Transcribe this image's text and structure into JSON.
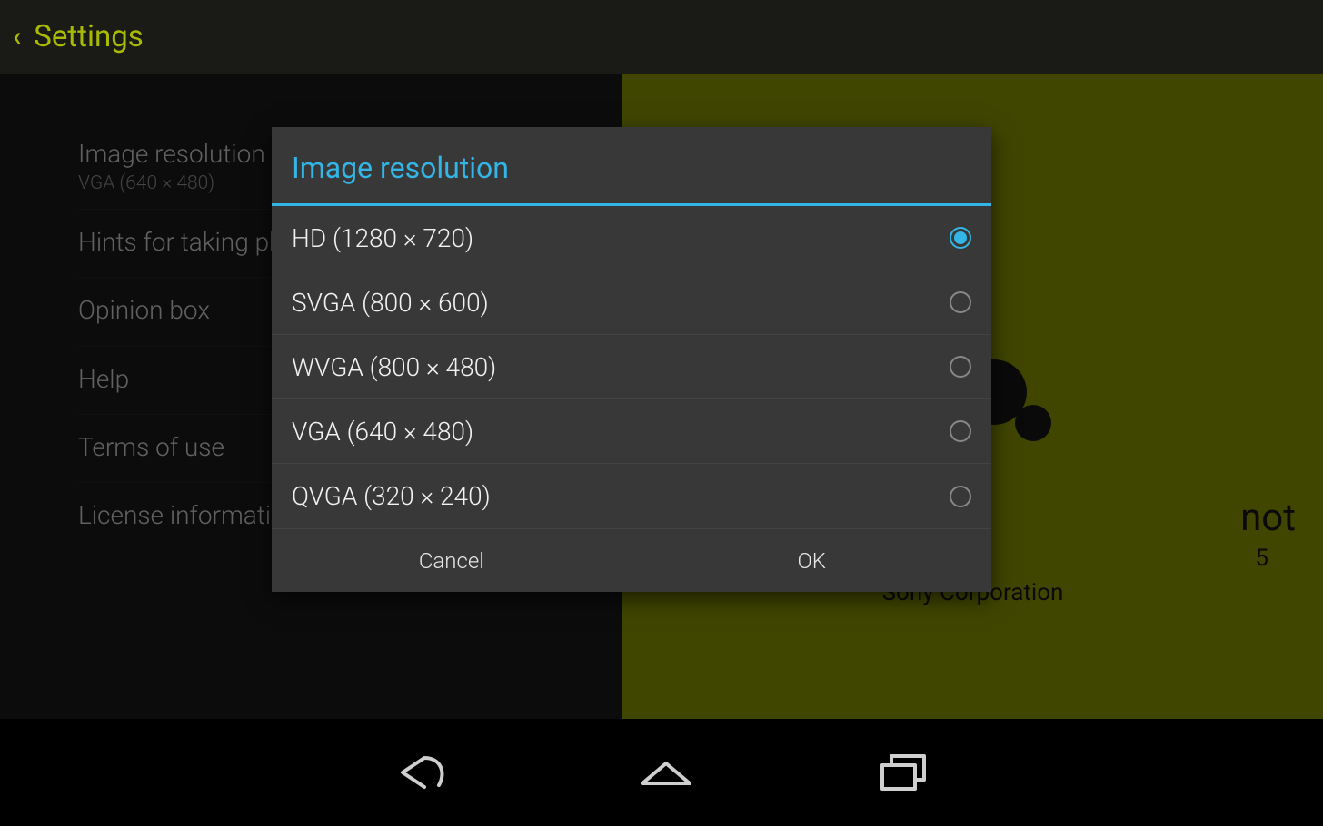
{
  "header": {
    "title": "Settings"
  },
  "settings": {
    "items": [
      {
        "title": "Image resolution",
        "sub": "VGA (640 × 480)"
      },
      {
        "title": "Hints for taking photos"
      },
      {
        "title": "Opinion box"
      },
      {
        "title": "Help"
      },
      {
        "title": "Terms of use"
      },
      {
        "title": "License information"
      }
    ]
  },
  "about": {
    "app_name_partial": "not",
    "version_partial": "5",
    "copyright_partial": "Sony Corporation"
  },
  "dialog": {
    "title": "Image resolution",
    "options": [
      {
        "label": "HD (1280 × 720)",
        "selected": true
      },
      {
        "label": "SVGA (800 × 600)",
        "selected": false
      },
      {
        "label": "WVGA (800 × 480)",
        "selected": false
      },
      {
        "label": "VGA (640 × 480)",
        "selected": false
      },
      {
        "label": "QVGA (320 × 240)",
        "selected": false
      }
    ],
    "cancel_label": "Cancel",
    "ok_label": "OK"
  },
  "colors": {
    "accent": "#33b5e5",
    "brand": "#a8bb00",
    "panel_green": "#99a800"
  }
}
